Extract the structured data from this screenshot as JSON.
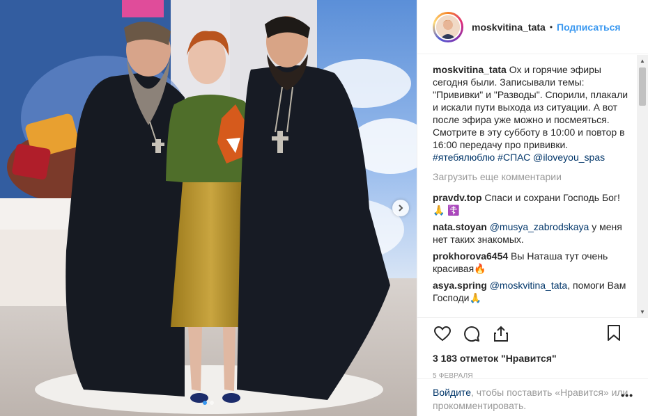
{
  "header": {
    "username": "moskvitina_tata",
    "separator": "•",
    "follow_label": "Подписаться"
  },
  "caption": {
    "username": "moskvitina_tata",
    "text": " Ох и горячие эфиры сегодня были. Записывали темы: \"Прививки\" и \"Разводы\". Спорили, плакали и искали пути выхода из ситуации. А вот после эфира уже можно и посмеяться. Смотрите в эту субботу в 10:00 и повтор в 16:00 передачу про прививки. ",
    "tag1": "#ятебялюблю",
    "tag2": "#СПАС",
    "mention": "@iloveyou_spas"
  },
  "load_more": "Загрузить еще комментарии",
  "comments": [
    {
      "user": "pravdv.top",
      "pre": " Спаси и сохрани Господь Бог! ",
      "mention": "",
      "post": "🙏 ☦️"
    },
    {
      "user": "nata.stoyan",
      "pre": " ",
      "mention": "@musya_zabrodskaya",
      "post": " у меня нет таких знакомых."
    },
    {
      "user": "prokhorova6454",
      "pre": " Вы Наташа тут очень красивая🔥",
      "mention": "",
      "post": ""
    },
    {
      "user": "asya.spring",
      "pre": " ",
      "mention": "@moskvitina_tata",
      "post": ", помоги Вам Господи🙏"
    }
  ],
  "likes": "3 183 отметок \"Нравится\"",
  "date": "5 февраля",
  "login": {
    "link": "Войдите",
    "text": ", чтобы поставить «Нравится» или прокомментировать.",
    "more": "•••"
  },
  "icons": {
    "like": "heart-icon",
    "comment": "comment-icon",
    "share": "share-icon",
    "save": "bookmark-icon",
    "next": "chevron-right-icon"
  },
  "colors": {
    "link_blue": "#3897f0",
    "mention_blue": "#003569",
    "muted": "#999999",
    "text": "#262626"
  },
  "carousel": {
    "slides": 2,
    "active": 1
  }
}
